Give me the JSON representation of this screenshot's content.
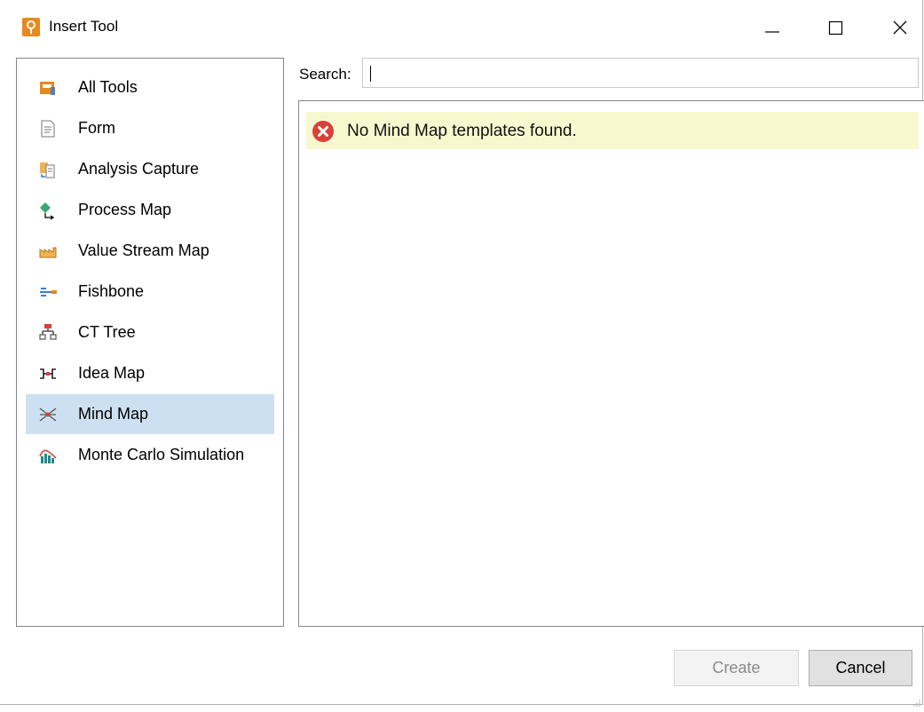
{
  "window": {
    "title": "Insert Tool"
  },
  "sidebar": {
    "items": [
      {
        "label": "All Tools",
        "icon": "all-tools-icon"
      },
      {
        "label": "Form",
        "icon": "form-icon"
      },
      {
        "label": "Analysis Capture",
        "icon": "analysis-capture-icon"
      },
      {
        "label": "Process Map",
        "icon": "process-map-icon"
      },
      {
        "label": "Value Stream Map",
        "icon": "value-stream-map-icon"
      },
      {
        "label": "Fishbone",
        "icon": "fishbone-icon"
      },
      {
        "label": "CT Tree",
        "icon": "ct-tree-icon"
      },
      {
        "label": "Idea Map",
        "icon": "idea-map-icon"
      },
      {
        "label": "Mind Map",
        "icon": "mind-map-icon",
        "selected": true
      },
      {
        "label": "Monte Carlo Simulation",
        "icon": "monte-carlo-icon"
      }
    ]
  },
  "search": {
    "label": "Search:",
    "value": ""
  },
  "content": {
    "message": "No Mind Map templates found.",
    "message_icon": "error-icon"
  },
  "footer": {
    "create_label": "Create",
    "cancel_label": "Cancel"
  },
  "colors": {
    "selection": "#cde0f1",
    "message_bg": "#f8f8cf",
    "error": "#d9413a",
    "accent": "#e8891c"
  }
}
